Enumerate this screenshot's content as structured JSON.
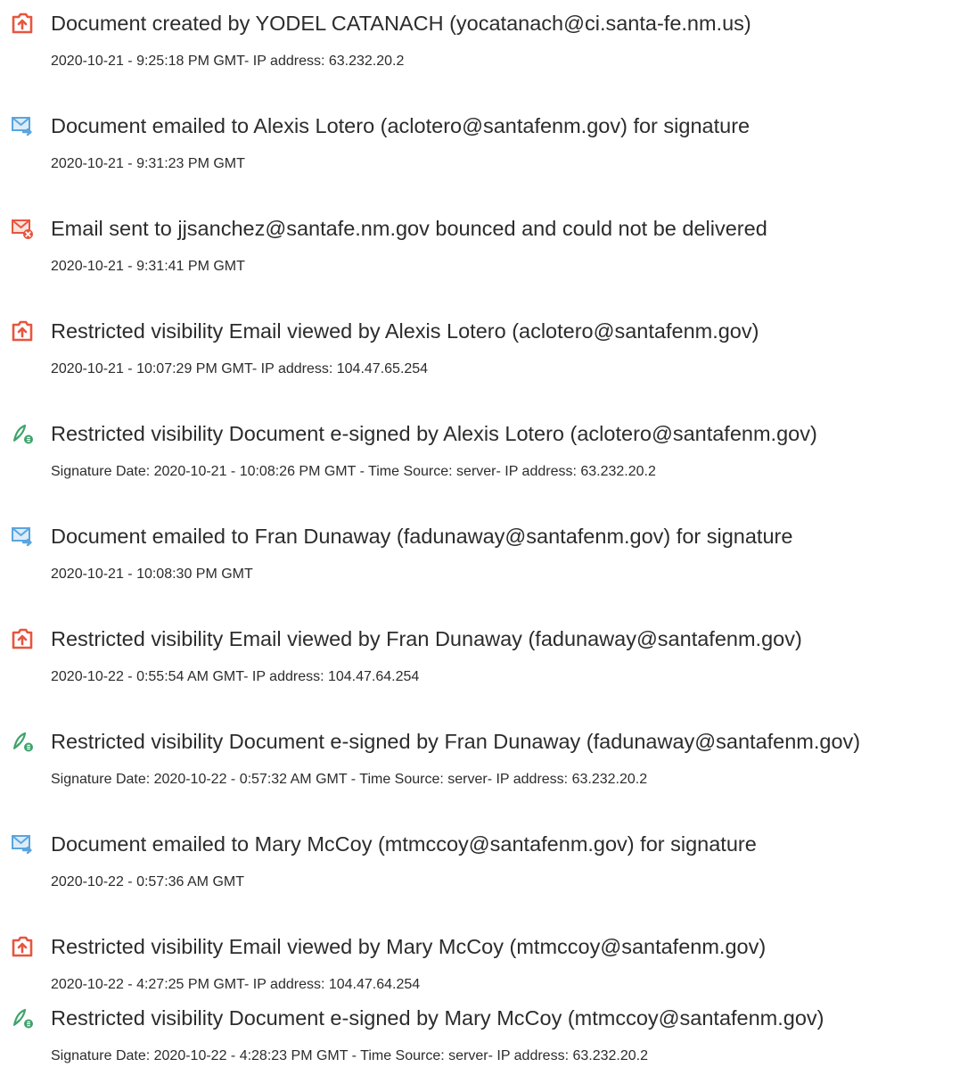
{
  "events": [
    {
      "icon": "document-created-icon",
      "title": "Document created by YODEL CATANACH (yocatanach@ci.santa-fe.nm.us)",
      "detail": "2020-10-21 - 9:25:18 PM GMT- IP address: 63.232.20.2"
    },
    {
      "icon": "email-sent-icon",
      "title": "Document emailed to Alexis Lotero (aclotero@santafenm.gov) for signature",
      "detail": "2020-10-21 - 9:31:23 PM GMT"
    },
    {
      "icon": "email-bounced-icon",
      "title": "Email sent to jjsanchez@santafe.nm.gov bounced and could not be delivered",
      "detail": "2020-10-21 - 9:31:41 PM GMT"
    },
    {
      "icon": "email-viewed-icon",
      "title": "Restricted visibility Email viewed by Alexis Lotero (aclotero@santafenm.gov)",
      "detail": "2020-10-21 - 10:07:29 PM GMT- IP address: 104.47.65.254"
    },
    {
      "icon": "e-signed-icon",
      "title": "Restricted visibility Document e-signed by Alexis Lotero (aclotero@santafenm.gov)",
      "detail": "Signature Date: 2020-10-21 - 10:08:26 PM GMT - Time Source: server- IP address: 63.232.20.2"
    },
    {
      "icon": "email-sent-icon",
      "title": "Document emailed to Fran Dunaway (fadunaway@santafenm.gov) for signature",
      "detail": "2020-10-21 - 10:08:30 PM GMT"
    },
    {
      "icon": "email-viewed-icon",
      "title": "Restricted visibility Email viewed by Fran Dunaway (fadunaway@santafenm.gov)",
      "detail": "2020-10-22 - 0:55:54 AM GMT- IP address: 104.47.64.254"
    },
    {
      "icon": "e-signed-icon",
      "title": "Restricted visibility Document e-signed by Fran Dunaway (fadunaway@santafenm.gov)",
      "detail": "Signature Date: 2020-10-22 - 0:57:32 AM GMT - Time Source: server- IP address: 63.232.20.2"
    },
    {
      "icon": "email-sent-icon",
      "title": "Document emailed to Mary McCoy (mtmccoy@santafenm.gov) for signature",
      "detail": "2020-10-22 - 0:57:36 AM GMT"
    },
    {
      "icon": "email-viewed-icon",
      "title": "Restricted visibility Email viewed by Mary McCoy (mtmccoy@santafenm.gov)",
      "detail": "2020-10-22 - 4:27:25 PM GMT- IP address: 104.47.64.254"
    },
    {
      "icon": "e-signed-icon",
      "title": "Restricted visibility Document e-signed by Mary McCoy (mtmccoy@santafenm.gov)",
      "detail": "Signature Date: 2020-10-22 - 4:28:23 PM GMT - Time Source: server- IP address: 63.232.20.2"
    }
  ],
  "colors": {
    "document_icon": "#e8553e",
    "email_icon": "#5aa5de",
    "bounce_badge": "#e8553e",
    "sign_icon": "#3fa36b",
    "text": "#2c2c2c"
  }
}
